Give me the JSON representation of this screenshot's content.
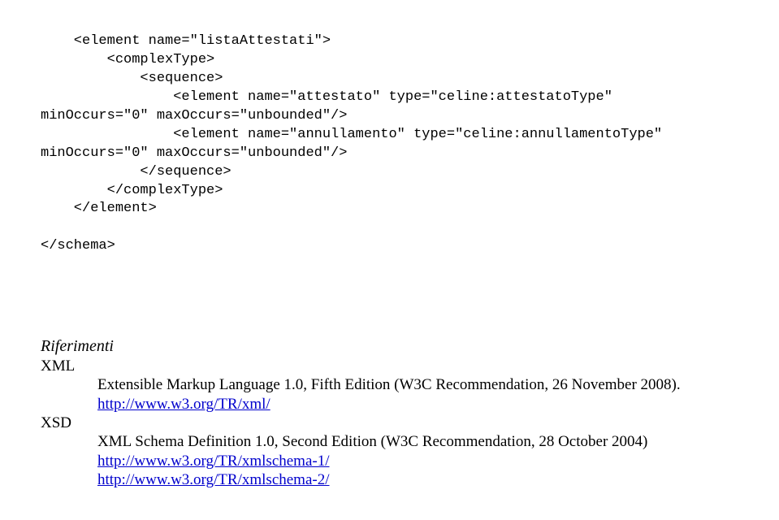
{
  "code": {
    "l1": "    <element name=\"listaAttestati\">",
    "l2": "        <complexType>",
    "l3": "            <sequence>",
    "l4": "                <element name=\"attestato\" type=\"celine:attestatoType\"",
    "l5": "minOccurs=\"0\" maxOccurs=\"unbounded\"/>",
    "l6": "                <element name=\"annullamento\" type=\"celine:annullamentoType\"",
    "l7": "minOccurs=\"0\" maxOccurs=\"unbounded\"/>",
    "l8": "            </sequence>",
    "l9": "        </complexType>",
    "l10": "    </element>",
    "l11": "",
    "l12": "</schema>"
  },
  "refs": {
    "heading": " Riferimenti",
    "xml": {
      "abbr": "XML",
      "desc": "Extensible Markup Language 1.0, Fifth Edition (W3C Recommendation, 26 November 2008).",
      "link": "http://www.w3.org/TR/xml/"
    },
    "xsd": {
      "abbr": "XSD",
      "desc": "XML Schema Definition 1.0, Second Edition (W3C Recommendation, 28 October 2004)",
      "link1": "http://www.w3.org/TR/xmlschema-1/",
      "link2": "http://www.w3.org/TR/xmlschema-2/"
    }
  }
}
